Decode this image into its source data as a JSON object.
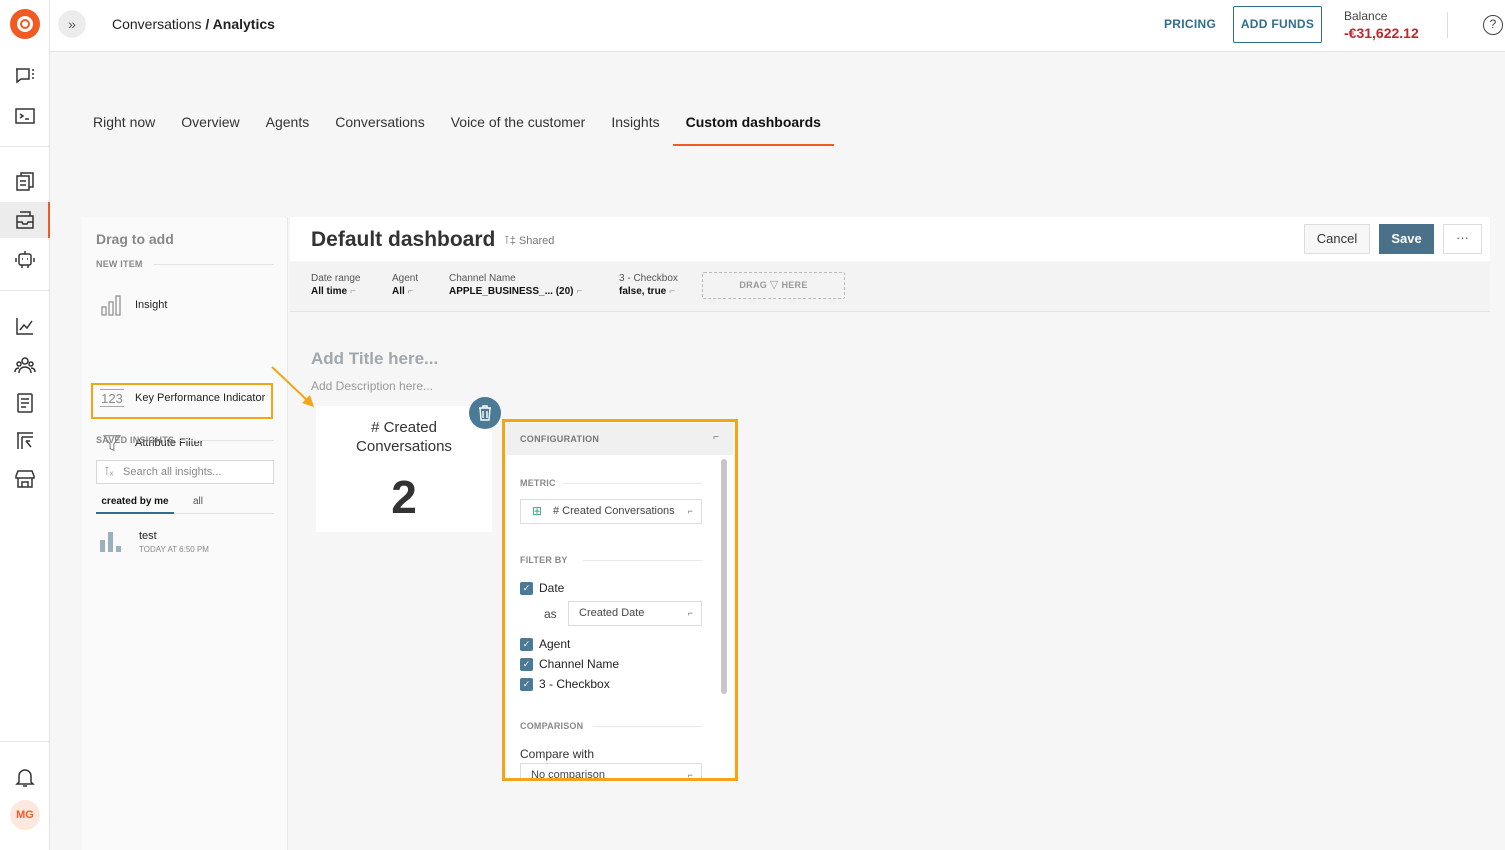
{
  "topbar": {
    "breadcrumb_parent": "Conversations",
    "breadcrumb_sep": " / ",
    "breadcrumb_current": "Analytics",
    "pricing": "PRICING",
    "add_funds": "ADD FUNDS",
    "balance_label": "Balance",
    "balance_value": "-€31,622.12",
    "help": "?"
  },
  "user": {
    "initials": "MG"
  },
  "tabs": [
    {
      "label": "Right now"
    },
    {
      "label": "Overview"
    },
    {
      "label": "Agents"
    },
    {
      "label": "Conversations"
    },
    {
      "label": "Voice of the customer"
    },
    {
      "label": "Insights"
    },
    {
      "label": "Custom dashboards",
      "active": true
    }
  ],
  "panel": {
    "title": "Drag to add",
    "new_item_label": "NEW ITEM",
    "items": [
      {
        "label": "Insight",
        "icon": "bar-chart-icon"
      },
      {
        "label": "Key Performance Indicator",
        "icon": "kpi-123-icon"
      },
      {
        "label": "Attribute Filter",
        "icon": "funnel-icon"
      }
    ],
    "saved_label": "SAVED INSIGHTS",
    "search_placeholder": "Search all insights...",
    "subtabs": [
      "created by me",
      "all"
    ],
    "saved_items": [
      {
        "name": "test",
        "time": "TODAY AT 6:50 PM"
      }
    ]
  },
  "dashboard": {
    "title": "Default dashboard",
    "shared": "Shared",
    "cancel": "Cancel",
    "save": "Save",
    "more": "···",
    "filters": [
      {
        "label": "Date range",
        "value": "All time",
        "count": ""
      },
      {
        "label": "Agent",
        "value": "All",
        "count": ""
      },
      {
        "label": "Channel Name",
        "value": "APPLE_BUSINESS_...",
        "count": "(20)"
      },
      {
        "label": "3 - Checkbox",
        "value": "false, true",
        "count": ""
      }
    ],
    "drag_here_left": "DRAG",
    "drag_here_right": "HERE",
    "add_title": "Add Title here...",
    "add_description": "Add Description here..."
  },
  "kpi": {
    "title_line1": "# Created",
    "title_line2": "Conversations",
    "value": "2"
  },
  "config": {
    "title": "CONFIGURATION",
    "metric_label": "METRIC",
    "metric_value": "# Created Conversations",
    "filter_by_label": "FILTER BY",
    "date_label": "Date",
    "as_label": "as",
    "date_as_value": "Created Date",
    "checks": [
      "Agent",
      "Channel Name",
      "3 - Checkbox"
    ],
    "comparison_label": "COMPARISON",
    "compare_with_label": "Compare with",
    "compare_value": "No comparison"
  },
  "colors": {
    "brand": "#f15a22",
    "accent": "#2f6e8e",
    "highlight": "#f2a516",
    "negative": "#c0262d"
  }
}
